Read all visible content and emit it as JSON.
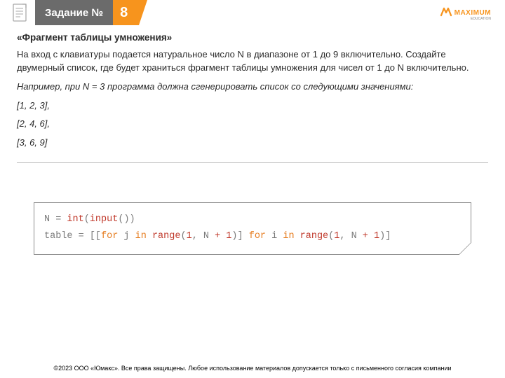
{
  "header": {
    "title": "Задание №",
    "number": "8",
    "logo_text": "MAXIMUM",
    "logo_sub": "EDUCATION"
  },
  "content": {
    "subtitle": "«Фрагмент таблицы умножения»",
    "p1": "На вход с клавиатуры подается натуральное число N в диапазоне от 1 до 9 включительно. Создайте двумерный список, где будет храниться фрагмент таблицы умножения для чисел от 1 до N включительно.",
    "p2": "Например, при N = 3 программа должна сгенерировать список со следующими значениями:",
    "rows": [
      "[1, 2, 3],",
      "[2, 4, 6],",
      "[3, 6, 9]"
    ]
  },
  "code": {
    "line1_a": "N ",
    "line1_op": "= ",
    "line1_b": "int",
    "line1_c": "(",
    "line1_d": "input",
    "line1_e": "())",
    "line2_a": "table ",
    "line2_op": "= ",
    "line2_b": "[[",
    "line2_for1": "for",
    "line2_c": " j ",
    "line2_in1": "in",
    "line2_d": " ",
    "line2_range1": "range",
    "line2_e": "(",
    "line2_num1": "1",
    "line2_f": ", N ",
    "line2_plus1": "+ ",
    "line2_num2": "1",
    "line2_g": ")] ",
    "line2_for2": "for",
    "line2_h": " i ",
    "line2_in2": "in",
    "line2_i": " ",
    "line2_range2": "range",
    "line2_j": "(",
    "line2_num3": "1",
    "line2_k": ", N ",
    "line2_plus2": "+ ",
    "line2_num4": "1",
    "line2_l": ")]"
  },
  "footer": {
    "copyright": "©2023 ООО «Юмакс». Все права защищены. Любое использование материалов допускается только с письменного согласия компании"
  }
}
